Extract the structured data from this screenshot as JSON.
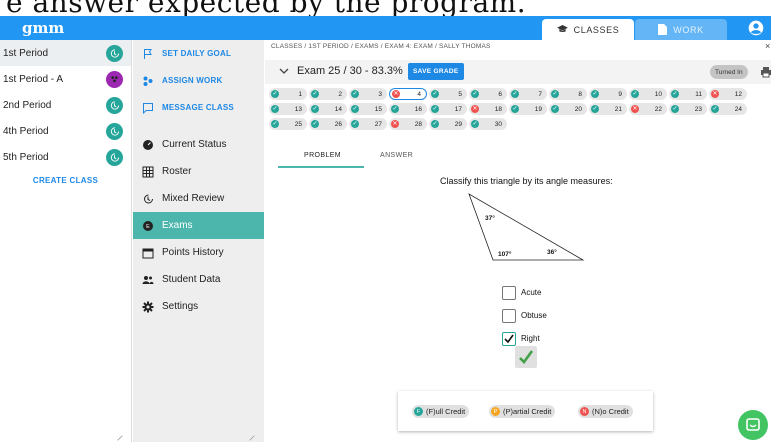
{
  "caption": {
    "text": "e answer expected by the program."
  },
  "app": {
    "logo": "gmm"
  },
  "header": {
    "tabs": [
      {
        "label": "CLASSES"
      },
      {
        "label": "WORK"
      }
    ]
  },
  "classes": {
    "items": [
      {
        "label": "1st Period"
      },
      {
        "label": "1st Period - A"
      },
      {
        "label": "2nd Period"
      },
      {
        "label": "4th Period"
      },
      {
        "label": "5th Period"
      }
    ],
    "create_label": "CREATE CLASS"
  },
  "nav": {
    "actions": [
      {
        "label": "SET DAILY GOAL",
        "icon": "flag-icon"
      },
      {
        "label": "ASSIGN WORK",
        "icon": "assign-icon"
      },
      {
        "label": "MESSAGE CLASS",
        "icon": "message-icon"
      }
    ],
    "items": [
      {
        "label": "Current Status",
        "icon": "gauge-icon"
      },
      {
        "label": "Roster",
        "icon": "table-icon"
      },
      {
        "label": "Mixed Review",
        "icon": "history-icon"
      },
      {
        "label": "Exams",
        "icon": "exam-icon"
      },
      {
        "label": "Points History",
        "icon": "calendar-icon"
      },
      {
        "label": "Student Data",
        "icon": "people-icon"
      },
      {
        "label": "Settings",
        "icon": "gear-icon"
      }
    ]
  },
  "breadcrumb": {
    "text": "CLASSES / 1ST PERIOD / EXAMS / EXAM 4: EXAM / SALLY THOMAS"
  },
  "exam": {
    "title": "Exam 25 / 30 - 83.3%",
    "save_label": "SAVE GRADE",
    "status": "Turned In"
  },
  "questions": [
    {
      "n": "1",
      "status": "correct"
    },
    {
      "n": "2",
      "status": "correct"
    },
    {
      "n": "3",
      "status": "correct"
    },
    {
      "n": "4",
      "status": "incorrect",
      "current": true
    },
    {
      "n": "5",
      "status": "correct"
    },
    {
      "n": "6",
      "status": "correct"
    },
    {
      "n": "7",
      "status": "correct"
    },
    {
      "n": "8",
      "status": "correct"
    },
    {
      "n": "9",
      "status": "correct"
    },
    {
      "n": "10",
      "status": "correct"
    },
    {
      "n": "11",
      "status": "correct"
    },
    {
      "n": "12",
      "status": "incorrect"
    },
    {
      "n": "13",
      "status": "correct"
    },
    {
      "n": "14",
      "status": "correct"
    },
    {
      "n": "15",
      "status": "correct"
    },
    {
      "n": "16",
      "status": "correct"
    },
    {
      "n": "17",
      "status": "correct"
    },
    {
      "n": "18",
      "status": "incorrect"
    },
    {
      "n": "19",
      "status": "correct"
    },
    {
      "n": "20",
      "status": "correct"
    },
    {
      "n": "21",
      "status": "correct"
    },
    {
      "n": "22",
      "status": "incorrect"
    },
    {
      "n": "23",
      "status": "correct"
    },
    {
      "n": "24",
      "status": "correct"
    },
    {
      "n": "25",
      "status": "correct"
    },
    {
      "n": "26",
      "status": "correct"
    },
    {
      "n": "27",
      "status": "correct"
    },
    {
      "n": "28",
      "status": "incorrect"
    },
    {
      "n": "29",
      "status": "correct"
    },
    {
      "n": "30",
      "status": "correct"
    }
  ],
  "view_tabs": [
    {
      "label": "PROBLEM"
    },
    {
      "label": "ANSWER"
    }
  ],
  "problem": {
    "prompt": "Classify this triangle by its angle measures:",
    "angles": [
      "37°",
      "107°",
      "36°"
    ],
    "choices": [
      {
        "label": "Acute",
        "checked": false
      },
      {
        "label": "Obtuse",
        "checked": false
      },
      {
        "label": "Right",
        "checked": true
      }
    ]
  },
  "credit": {
    "options": [
      {
        "badge": "F",
        "label": "(F)ull Credit",
        "color": "#26a69a"
      },
      {
        "badge": "P",
        "label": "(P)artial Credit",
        "color": "#f5a623"
      },
      {
        "badge": "N",
        "label": "(N)o Credit",
        "color": "#ef5350"
      }
    ]
  },
  "colors": {
    "brand": "#2196f3",
    "teal": "#26a69a",
    "nav_active": "#4db6ac",
    "error": "#ef5350",
    "link": "#1e88e5"
  }
}
